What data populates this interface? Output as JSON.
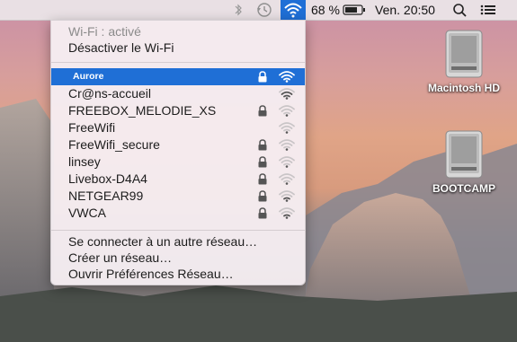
{
  "menubar": {
    "battery_percent": "68 %",
    "clock": "Ven. 20:50",
    "icons": [
      "bluetooth-icon",
      "time-machine-icon",
      "wifi-icon",
      "battery-icon",
      "search-icon",
      "notification-list-icon"
    ]
  },
  "wifi_menu": {
    "status": "Wi-Fi : activé",
    "toggle_label": "Désactiver le Wi-Fi",
    "networks": [
      {
        "name": "Aurore",
        "locked": true,
        "signal": 4,
        "selected": true
      },
      {
        "name": "Cr@ns-accueil",
        "locked": false,
        "signal": 3,
        "selected": false
      },
      {
        "name": "FREEBOX_MELODIE_XS",
        "locked": true,
        "signal": 1,
        "selected": false
      },
      {
        "name": "FreeWifi",
        "locked": false,
        "signal": 1,
        "selected": false
      },
      {
        "name": "FreeWifi_secure",
        "locked": true,
        "signal": 1,
        "selected": false
      },
      {
        "name": "linsey",
        "locked": true,
        "signal": 1,
        "selected": false
      },
      {
        "name": "Livebox-D4A4",
        "locked": true,
        "signal": 1,
        "selected": false
      },
      {
        "name": "NETGEAR99",
        "locked": true,
        "signal": 2,
        "selected": false
      },
      {
        "name": "VWCA",
        "locked": true,
        "signal": 2,
        "selected": false
      }
    ],
    "actions": {
      "other_network": "Se connecter à un autre réseau…",
      "create_network": "Créer un réseau…",
      "open_prefs": "Ouvrir Préférences Réseau…"
    }
  },
  "desktop": {
    "drives": [
      "Macintosh HD",
      "BOOTCAMP"
    ]
  },
  "colors": {
    "selection": "#1f6fd6",
    "menu_bg": "#f6eef2",
    "signal_active": "#555555",
    "signal_inactive": "#c9c5c7"
  }
}
